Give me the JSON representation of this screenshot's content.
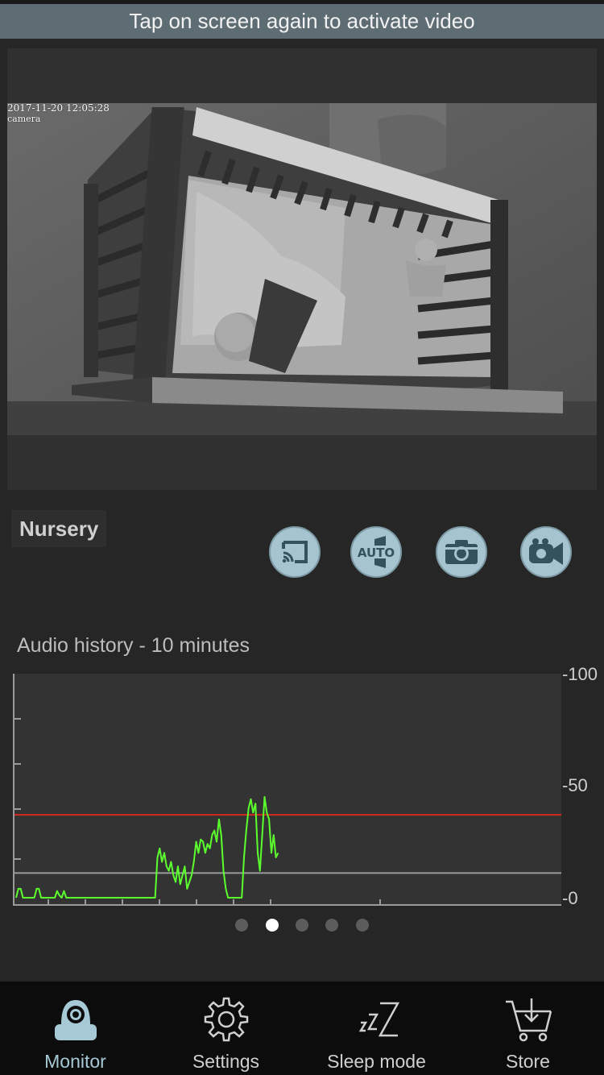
{
  "banner": {
    "text": "Tap on screen again to activate video"
  },
  "video": {
    "timestamp": "2017-11-20 12:05:28",
    "camera_label": "camera"
  },
  "camera": {
    "name": "Nursery"
  },
  "controls": [
    {
      "icon": "cast-icon"
    },
    {
      "icon": "auto-volume-icon",
      "text": "AUTO"
    },
    {
      "icon": "camera-icon"
    },
    {
      "icon": "video-record-icon"
    }
  ],
  "audio": {
    "title": "Audio history -  10 minutes"
  },
  "chart_data": {
    "type": "line",
    "title": "Audio history -  10 minutes",
    "ylim": [
      0,
      100
    ],
    "yticks": [
      "-100",
      "-50",
      "-0"
    ],
    "threshold_red": 37,
    "threshold_gray": 11,
    "series": [
      {
        "color": "#5cff2e",
        "values": [
          0,
          4,
          4,
          0,
          0,
          0,
          0,
          0,
          0,
          4,
          4,
          0,
          0,
          0,
          0,
          0,
          0,
          0,
          3,
          1,
          0,
          3,
          0,
          0,
          0,
          0,
          0,
          0,
          0,
          0,
          0,
          0,
          0,
          0,
          0,
          0,
          0,
          0,
          0,
          0,
          0,
          0,
          0,
          0,
          0,
          0,
          0,
          0,
          0,
          0,
          0,
          0,
          0,
          0,
          0,
          0,
          0,
          0,
          0,
          0,
          0,
          0,
          18,
          22,
          16,
          20,
          14,
          12,
          16,
          10,
          7,
          14,
          6,
          10,
          14,
          4,
          7,
          10,
          16,
          25,
          20,
          26,
          25,
          20,
          24,
          22,
          28,
          30,
          25,
          35,
          28,
          12,
          4,
          0,
          0,
          0,
          0,
          0,
          0,
          0,
          18,
          30,
          40,
          44,
          38,
          42,
          20,
          12,
          28,
          45,
          38,
          35,
          20,
          28,
          18,
          20
        ]
      }
    ],
    "pagination": {
      "count": 5,
      "active": 1
    }
  },
  "tabs": [
    {
      "label": "Monitor",
      "icon": "monitor-camera-icon",
      "selected": true
    },
    {
      "label": "Settings",
      "icon": "gear-icon",
      "selected": false
    },
    {
      "label": "Sleep mode",
      "icon": "sleep-zzz-icon",
      "selected": false
    },
    {
      "label": "Store",
      "icon": "shopping-cart-icon",
      "selected": false
    }
  ],
  "colors": {
    "banner": "#5e6c74",
    "control_button": "#a6c4cf",
    "control_icon": "#34525e",
    "active_tab": "#a7c9d6",
    "series_line": "#5cff2e",
    "threshold_red": "#d32a1e",
    "threshold_gray": "#9a9a9a"
  }
}
